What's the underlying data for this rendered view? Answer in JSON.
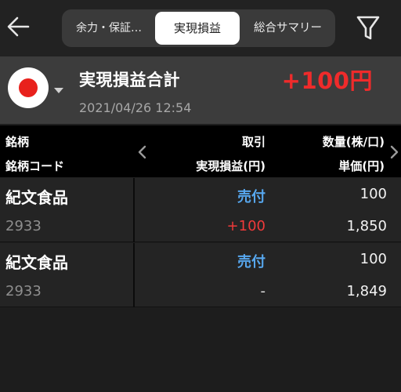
{
  "nav": {
    "back_icon": "arrow-left-icon",
    "tabs": [
      {
        "label": "余力・保証…"
      },
      {
        "label": "実現損益"
      },
      {
        "label": "総合サマリー"
      }
    ],
    "selected_tab": 1,
    "filter_icon": "filter-funnel-icon"
  },
  "summary": {
    "market_icon": "japan-flag-icon",
    "title": "実現損益合計",
    "value": "+100円",
    "timestamp": "2021/04/26 12:54"
  },
  "table": {
    "headers": {
      "stock": "銘柄",
      "stock_code": "銘柄コード",
      "trade": "取引",
      "realized_pnl": "実現損益(円)",
      "quantity": "数量(株/口)",
      "unit_price": "単価(円)"
    },
    "rows": [
      {
        "name": "紀文食品",
        "code": "2933",
        "side": "売付",
        "pnl": "+100",
        "quantity": "100",
        "price": "1,850"
      },
      {
        "name": "紀文食品",
        "code": "2933",
        "side": "売付",
        "pnl": "-",
        "quantity": "100",
        "price": "1,849"
      }
    ]
  },
  "colors": {
    "profit": "#ef2b2b",
    "sell": "#57a7ee",
    "background": "#1e1e1e"
  }
}
